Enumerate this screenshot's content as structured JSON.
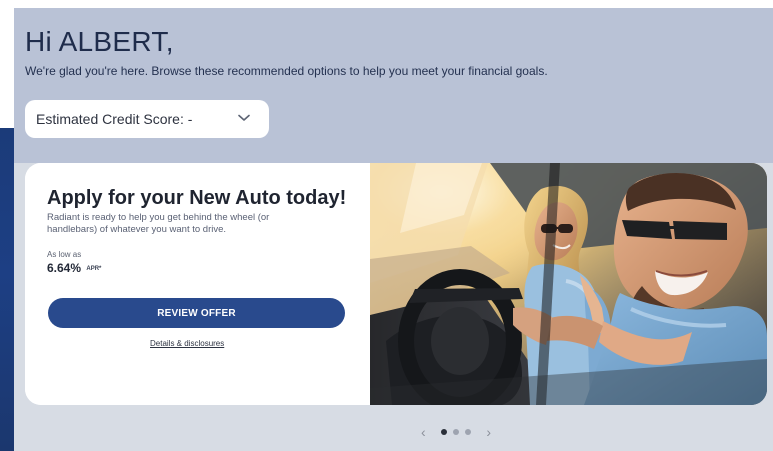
{
  "greeting": {
    "title": "Hi ALBERT,",
    "subtitle": "We're glad you're here. Browse these recommended options to help you meet your financial goals."
  },
  "credit_score_select": {
    "label": "Estimated Credit Score: -",
    "icon": "chevron-down-icon"
  },
  "offer": {
    "title": "Apply for your New Auto today!",
    "description": "Radiant is ready to help you get behind the wheel (or handlebars) of whatever you want to drive.",
    "rate_caption": "As low as",
    "rate_value": "6.64%",
    "rate_unit": "APR*",
    "button_label": "REVIEW OFFER",
    "details_link": "Details & disclosures"
  },
  "carousel": {
    "prev_icon": "chevron-left-icon",
    "next_icon": "chevron-right-icon",
    "prev_label": "‹",
    "next_label": "›",
    "dots_count": 3,
    "active_index": 0
  },
  "colors": {
    "header_background": "#b9c2d6",
    "lower_background": "#d7dce4",
    "accent": "#294a8d",
    "dark_text": "#1f2c4b"
  }
}
